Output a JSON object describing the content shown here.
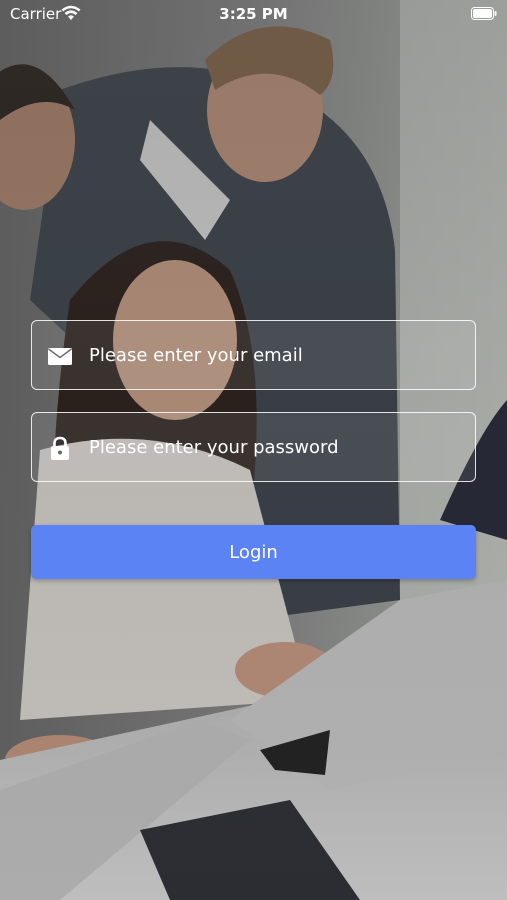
{
  "status_bar": {
    "carrier": "Carrier",
    "time": "3:25 PM",
    "wifi_icon": "wifi-icon",
    "battery_icon": "battery-icon"
  },
  "login": {
    "email": {
      "icon": "envelope-icon",
      "placeholder": "Please enter your email",
      "value": ""
    },
    "password": {
      "icon": "lock-icon",
      "placeholder": "Please enter your password",
      "value": ""
    },
    "button_label": "Login"
  },
  "colors": {
    "accent": "#5b83f4",
    "text": "#ffffff"
  }
}
